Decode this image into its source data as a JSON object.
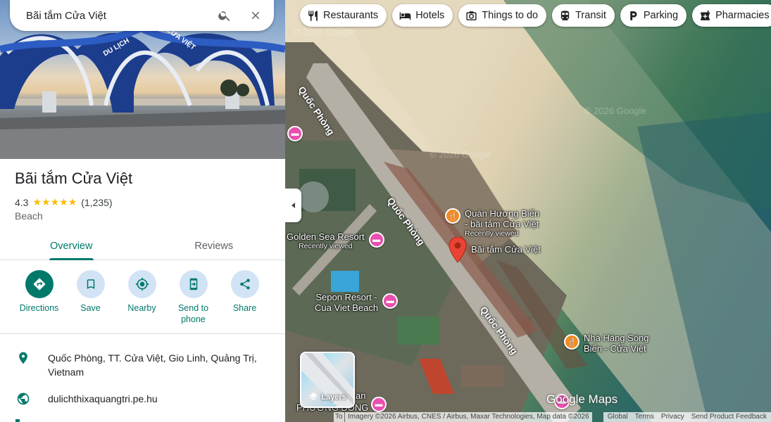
{
  "search": {
    "query": "Bãi tắm Cửa Việt"
  },
  "place": {
    "name": "Bãi tắm Cửa Việt",
    "rating": "4.3",
    "review_count": "(1,235)",
    "stars": "★★★★★",
    "category": "Beach",
    "hero_sign_left": "DU LỊCH",
    "hero_sign_right": "CỬA VIỆT"
  },
  "tabs": [
    {
      "label": "Overview",
      "active": true
    },
    {
      "label": "Reviews",
      "active": false
    }
  ],
  "actions": [
    {
      "label": "Directions",
      "icon": "directions-icon"
    },
    {
      "label": "Save",
      "icon": "bookmark-icon"
    },
    {
      "label": "Nearby",
      "icon": "nearby-icon"
    },
    {
      "label": "Send to phone",
      "icon": "send-to-phone-icon"
    },
    {
      "label": "Share",
      "icon": "share-icon"
    }
  ],
  "info": {
    "address": "Quốc Phòng, TT. Cửa Việt, Gio Linh, Quảng Trị, Vietnam",
    "website": "dulichthixaquangtri.pe.hu"
  },
  "chips": [
    {
      "label": "Restaurants",
      "icon": "fork-knife-icon"
    },
    {
      "label": "Hotels",
      "icon": "bed-icon"
    },
    {
      "label": "Things to do",
      "icon": "camera-icon"
    },
    {
      "label": "Transit",
      "icon": "train-icon"
    },
    {
      "label": "Parking",
      "icon": "parking-icon"
    },
    {
      "label": "Pharmacies",
      "icon": "pharmacy-icon"
    }
  ],
  "map": {
    "roads": [
      "Quốc Phòng",
      "Quốc Phòng",
      "Quốc Phòng"
    ],
    "pois": {
      "quan_huong_bien": {
        "name_line1": "Quán Hương Biển",
        "name_line2": "- bãi tắm Cửa Việt",
        "sub": "Recently viewed"
      },
      "selected": {
        "name": "Bãi tắm Cửa Việt"
      },
      "golden_sea": {
        "name": "Golden Sea Resort",
        "sub": "Recently viewed"
      },
      "sepon": {
        "name_line1": "Sepon Resort -",
        "name_line2": "Cua Viet Beach"
      },
      "nha_hang": {
        "name_line1": "Nhà Hàng Sóng",
        "name_line2": "Biển - Cửa Việt"
      },
      "phuong_dong_line1": "an",
      "phuong_dong_line2": "PHƯƠNG ĐÔNG"
    },
    "watermark": "© 2026 Google",
    "layers_label": "Layers",
    "logo": "Google Maps",
    "attribution_left": "To",
    "attribution": "Imagery ©2026 Airbus, CNES / Airbus, Maxar Technologies, Map data ©2026",
    "links": [
      "Global",
      "Terms",
      "Privacy",
      "Send Product Feedback"
    ]
  },
  "colors": {
    "accent": "#00796b",
    "selected_pin": "#ea4335",
    "food_pin": "#f28b24",
    "hotel_pin": "#e94fae",
    "star": "#fbbc04"
  }
}
